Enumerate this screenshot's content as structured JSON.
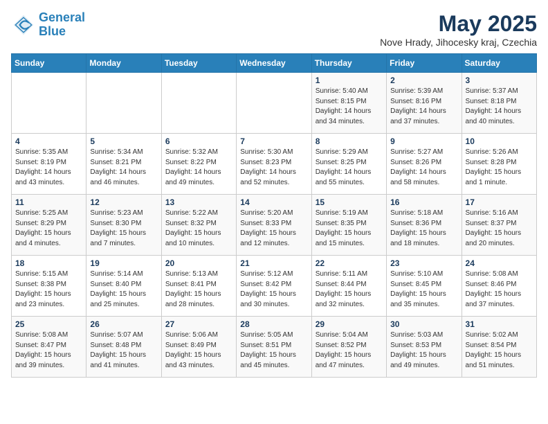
{
  "header": {
    "logo_line1": "General",
    "logo_line2": "Blue",
    "month_title": "May 2025",
    "subtitle": "Nove Hrady, Jihocesky kraj, Czechia"
  },
  "weekdays": [
    "Sunday",
    "Monday",
    "Tuesday",
    "Wednesday",
    "Thursday",
    "Friday",
    "Saturday"
  ],
  "weeks": [
    [
      {
        "day": "",
        "info": ""
      },
      {
        "day": "",
        "info": ""
      },
      {
        "day": "",
        "info": ""
      },
      {
        "day": "",
        "info": ""
      },
      {
        "day": "1",
        "info": "Sunrise: 5:40 AM\nSunset: 8:15 PM\nDaylight: 14 hours\nand 34 minutes."
      },
      {
        "day": "2",
        "info": "Sunrise: 5:39 AM\nSunset: 8:16 PM\nDaylight: 14 hours\nand 37 minutes."
      },
      {
        "day": "3",
        "info": "Sunrise: 5:37 AM\nSunset: 8:18 PM\nDaylight: 14 hours\nand 40 minutes."
      }
    ],
    [
      {
        "day": "4",
        "info": "Sunrise: 5:35 AM\nSunset: 8:19 PM\nDaylight: 14 hours\nand 43 minutes."
      },
      {
        "day": "5",
        "info": "Sunrise: 5:34 AM\nSunset: 8:21 PM\nDaylight: 14 hours\nand 46 minutes."
      },
      {
        "day": "6",
        "info": "Sunrise: 5:32 AM\nSunset: 8:22 PM\nDaylight: 14 hours\nand 49 minutes."
      },
      {
        "day": "7",
        "info": "Sunrise: 5:30 AM\nSunset: 8:23 PM\nDaylight: 14 hours\nand 52 minutes."
      },
      {
        "day": "8",
        "info": "Sunrise: 5:29 AM\nSunset: 8:25 PM\nDaylight: 14 hours\nand 55 minutes."
      },
      {
        "day": "9",
        "info": "Sunrise: 5:27 AM\nSunset: 8:26 PM\nDaylight: 14 hours\nand 58 minutes."
      },
      {
        "day": "10",
        "info": "Sunrise: 5:26 AM\nSunset: 8:28 PM\nDaylight: 15 hours\nand 1 minute."
      }
    ],
    [
      {
        "day": "11",
        "info": "Sunrise: 5:25 AM\nSunset: 8:29 PM\nDaylight: 15 hours\nand 4 minutes."
      },
      {
        "day": "12",
        "info": "Sunrise: 5:23 AM\nSunset: 8:30 PM\nDaylight: 15 hours\nand 7 minutes."
      },
      {
        "day": "13",
        "info": "Sunrise: 5:22 AM\nSunset: 8:32 PM\nDaylight: 15 hours\nand 10 minutes."
      },
      {
        "day": "14",
        "info": "Sunrise: 5:20 AM\nSunset: 8:33 PM\nDaylight: 15 hours\nand 12 minutes."
      },
      {
        "day": "15",
        "info": "Sunrise: 5:19 AM\nSunset: 8:35 PM\nDaylight: 15 hours\nand 15 minutes."
      },
      {
        "day": "16",
        "info": "Sunrise: 5:18 AM\nSunset: 8:36 PM\nDaylight: 15 hours\nand 18 minutes."
      },
      {
        "day": "17",
        "info": "Sunrise: 5:16 AM\nSunset: 8:37 PM\nDaylight: 15 hours\nand 20 minutes."
      }
    ],
    [
      {
        "day": "18",
        "info": "Sunrise: 5:15 AM\nSunset: 8:38 PM\nDaylight: 15 hours\nand 23 minutes."
      },
      {
        "day": "19",
        "info": "Sunrise: 5:14 AM\nSunset: 8:40 PM\nDaylight: 15 hours\nand 25 minutes."
      },
      {
        "day": "20",
        "info": "Sunrise: 5:13 AM\nSunset: 8:41 PM\nDaylight: 15 hours\nand 28 minutes."
      },
      {
        "day": "21",
        "info": "Sunrise: 5:12 AM\nSunset: 8:42 PM\nDaylight: 15 hours\nand 30 minutes."
      },
      {
        "day": "22",
        "info": "Sunrise: 5:11 AM\nSunset: 8:44 PM\nDaylight: 15 hours\nand 32 minutes."
      },
      {
        "day": "23",
        "info": "Sunrise: 5:10 AM\nSunset: 8:45 PM\nDaylight: 15 hours\nand 35 minutes."
      },
      {
        "day": "24",
        "info": "Sunrise: 5:08 AM\nSunset: 8:46 PM\nDaylight: 15 hours\nand 37 minutes."
      }
    ],
    [
      {
        "day": "25",
        "info": "Sunrise: 5:08 AM\nSunset: 8:47 PM\nDaylight: 15 hours\nand 39 minutes."
      },
      {
        "day": "26",
        "info": "Sunrise: 5:07 AM\nSunset: 8:48 PM\nDaylight: 15 hours\nand 41 minutes."
      },
      {
        "day": "27",
        "info": "Sunrise: 5:06 AM\nSunset: 8:49 PM\nDaylight: 15 hours\nand 43 minutes."
      },
      {
        "day": "28",
        "info": "Sunrise: 5:05 AM\nSunset: 8:51 PM\nDaylight: 15 hours\nand 45 minutes."
      },
      {
        "day": "29",
        "info": "Sunrise: 5:04 AM\nSunset: 8:52 PM\nDaylight: 15 hours\nand 47 minutes."
      },
      {
        "day": "30",
        "info": "Sunrise: 5:03 AM\nSunset: 8:53 PM\nDaylight: 15 hours\nand 49 minutes."
      },
      {
        "day": "31",
        "info": "Sunrise: 5:02 AM\nSunset: 8:54 PM\nDaylight: 15 hours\nand 51 minutes."
      }
    ]
  ]
}
